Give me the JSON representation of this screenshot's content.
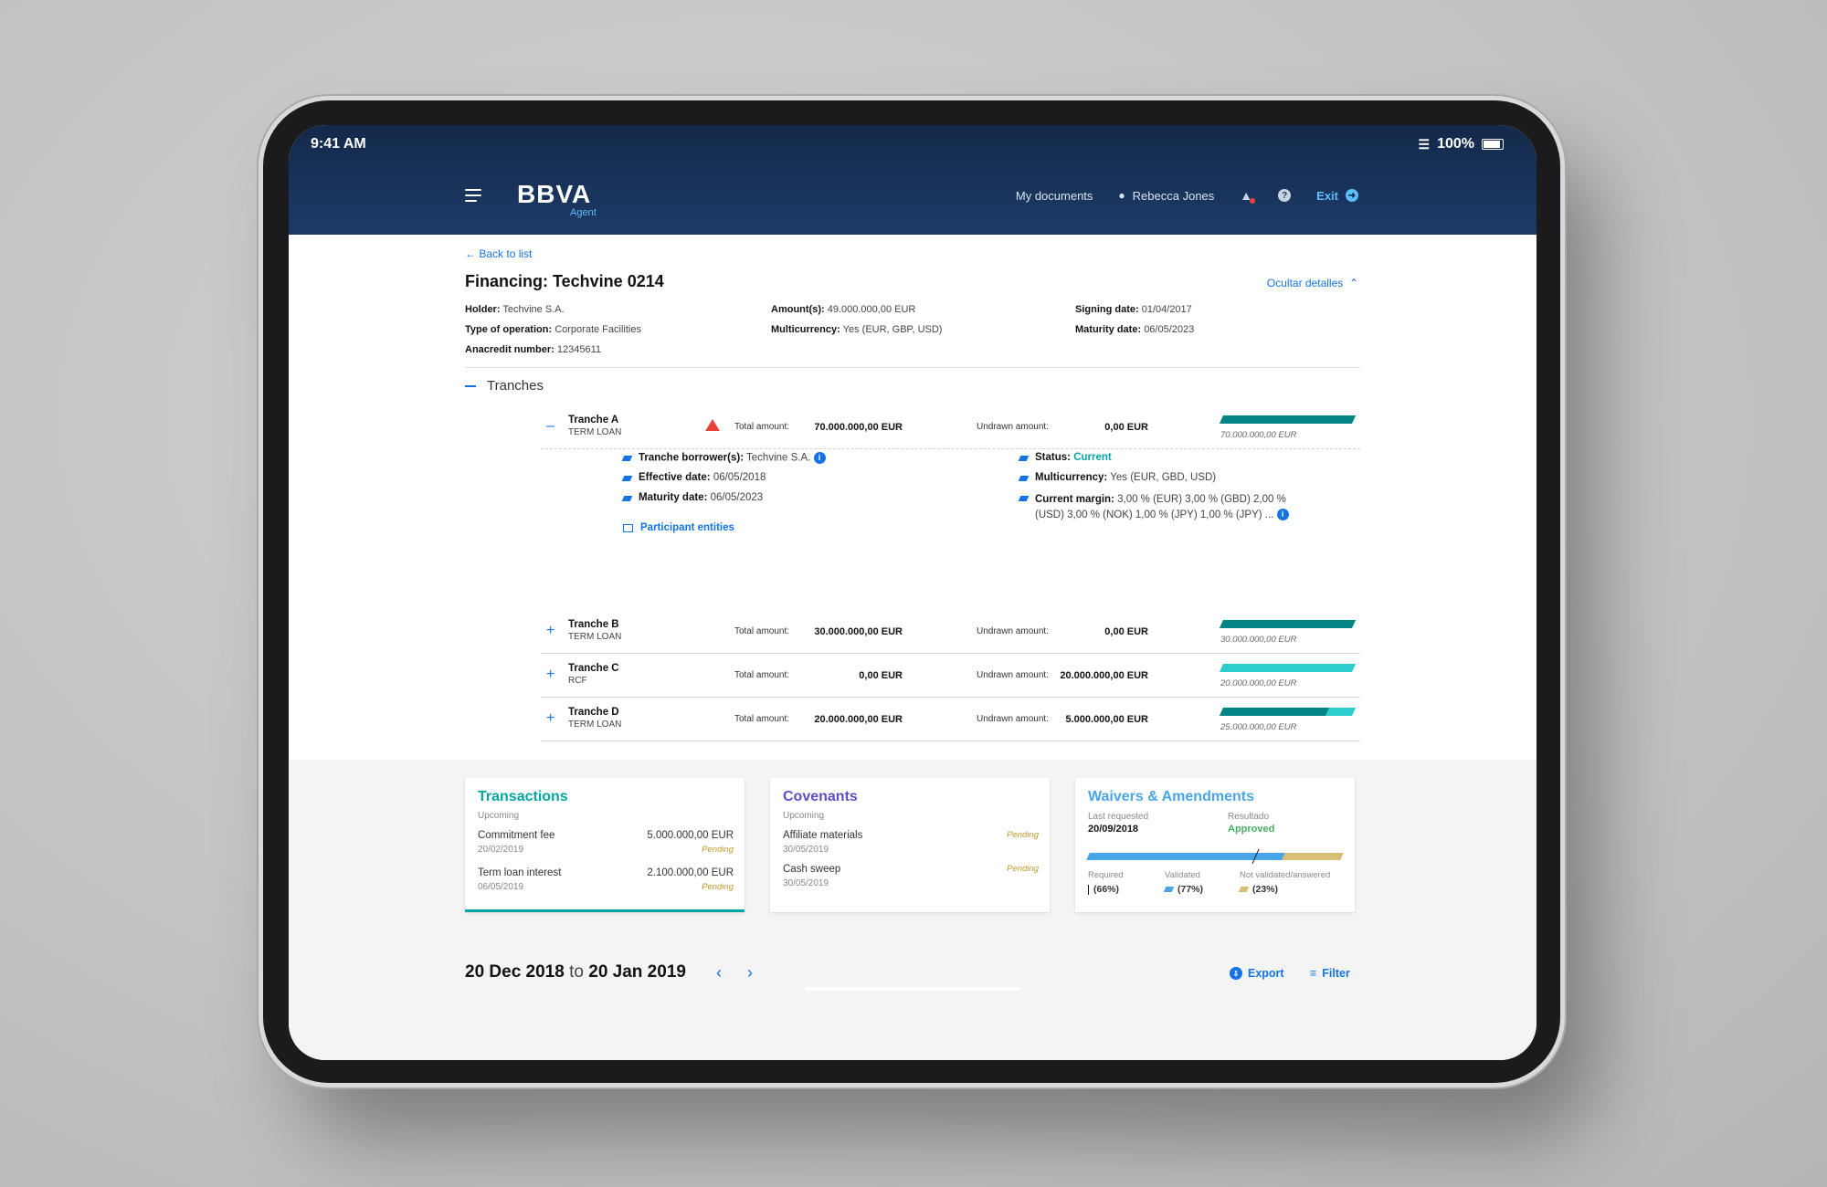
{
  "status_bar": {
    "time": "9:41 AM",
    "battery": "100%"
  },
  "nav": {
    "logo": "BBVA",
    "logo_sub": "Agent",
    "my_documents": "My documents",
    "user_name": "Rebecca Jones",
    "exit": "Exit"
  },
  "header": {
    "back": "Back to list",
    "title": "Financing: Techvine 0214",
    "toggle_details": "Ocultar detalles"
  },
  "summary": {
    "holder_label": "Holder:",
    "holder": "Techvine S.A.",
    "type_label": "Type of operation:",
    "type": "Corporate Facilities",
    "anacredit_label": "Anacredit number:",
    "anacredit": "12345611",
    "amounts_label": "Amount(s):",
    "amounts": "49.000.000,00 EUR",
    "multicurrency_label": "Multicurrency:",
    "multicurrency": "Yes (EUR, GBP, USD)",
    "signing_label": "Signing date:",
    "signing": "01/04/2017",
    "maturity_label": "Maturity date:",
    "maturity": "06/05/2023"
  },
  "tranches_title": "Tranches",
  "tranches": [
    {
      "name": "Tranche A",
      "type": "TERM LOAN",
      "total_label": "Total amount:",
      "total": "70.000.000,00 EUR",
      "undrawn_label": "Undrawn amount:",
      "undrawn": "0,00 EUR",
      "bar_caption": "70.000.000,00  EUR",
      "drawn_fraction": 1.0,
      "warning": true,
      "expanded": true
    },
    {
      "name": "Tranche B",
      "type": "TERM LOAN",
      "total_label": "Total amount:",
      "total": "30.000.000,00 EUR",
      "undrawn_label": "Undrawn amount:",
      "undrawn": "0,00 EUR",
      "bar_caption": "30.000.000,00 EUR",
      "drawn_fraction": 1.0
    },
    {
      "name": "Tranche C",
      "type": "RCF",
      "total_label": "Total amount:",
      "total": "0,00 EUR",
      "undrawn_label": "Undrawn amount:",
      "undrawn": "20.000.000,00 EUR",
      "bar_caption": "20.000.000,00  EUR",
      "drawn_fraction": 0.0
    },
    {
      "name": "Tranche D",
      "type": "TERM LOAN",
      "total_label": "Total amount:",
      "total": "20.000.000,00 EUR",
      "undrawn_label": "Undrawn amount:",
      "undrawn": "5.000.000,00 EUR",
      "bar_caption": "25.000.000,00 EUR",
      "drawn_fraction": 0.8
    }
  ],
  "tranche_a_details": {
    "borrower_label": "Tranche borrower(s):",
    "borrower": "Techvine S.A.",
    "effective_label": "Effective date:",
    "effective": "06/05/2018",
    "maturity_label": "Maturity date:",
    "maturity": "06/05/2023",
    "participants": "Participant entities",
    "status_label": "Status:",
    "status": "Current",
    "multicurrency_label": "Multicurrency:",
    "multicurrency": "Yes (EUR, GBD, USD)",
    "margin_label": "Current margin:",
    "margin_line1": "3,00 % (EUR)   3,00 % (GBD)   2,00 %",
    "margin_line2": "(USD)   3,00 % (NOK)   1,00 % (JPY)   1,00 % (JPY) ..."
  },
  "cards": {
    "transactions": {
      "title": "Transactions",
      "subtitle": "Upcoming",
      "items": [
        {
          "name": "Commitment fee",
          "amount": "5.000.000,00 EUR",
          "date": "20/02/2019",
          "status": "Pending"
        },
        {
          "name": "Term loan interest",
          "amount": "2.100.000,00 EUR",
          "date": "06/05/2019",
          "status": "Pending"
        }
      ]
    },
    "covenants": {
      "title": "Covenants",
      "subtitle": "Upcoming",
      "items": [
        {
          "name": "Affiliate materials",
          "date": "30/05/2019",
          "status": "Pending"
        },
        {
          "name": "Cash sweep",
          "date": "30/05/2019",
          "status": "Pending"
        }
      ]
    },
    "waivers": {
      "title": "Waivers & Amendments",
      "last_requested_label": "Last requested",
      "last_requested": "20/09/2018",
      "result_label": "Resultado",
      "result": "Approved",
      "required_label": "Required",
      "required": "(66%)",
      "validated_label": "Validated",
      "validated": "(77%)",
      "not_validated_label": "Not validated/answered",
      "not_validated": "(23%)",
      "required_fraction": 0.66,
      "validated_fraction": 0.77
    }
  },
  "footer": {
    "date_from": "20 Dec 2018",
    "date_to_word": "to",
    "date_to": "20 Jan 2019",
    "export": "Export",
    "filter": "Filter"
  },
  "colors": {
    "nav_bg": "#13294b",
    "accent_blue": "#1473e6",
    "teal_dark": "#028484",
    "teal_light": "#2dcccd",
    "transactions": "#02a5a5",
    "covenants": "#5b4fc9",
    "waivers": "#49a5e6",
    "pending": "#c09a2d",
    "approved": "#48ae64"
  }
}
